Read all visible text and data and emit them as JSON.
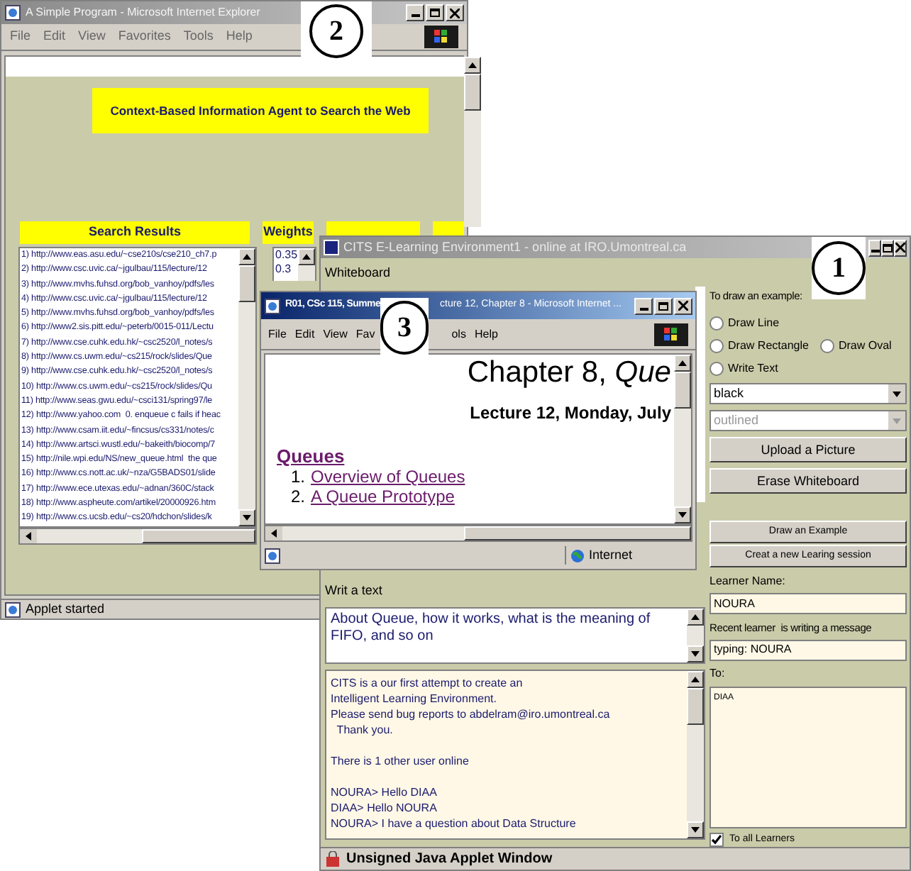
{
  "search_window": {
    "title": "A Simple Program - Microsoft Internet Explorer",
    "callout": "2",
    "menu": [
      "File",
      "Edit",
      "View",
      "Favorites",
      "Tools",
      "Help"
    ],
    "banner": "Context-Based Information Agent to Search the Web",
    "results_header": "Search Results",
    "weights_header": "Weights",
    "results": [
      "1) http://www.eas.asu.edu/~cse210s/cse210_ch7.p",
      "2) http://www.csc.uvic.ca/~jgulbau/115/lecture/12",
      "3) http://www.mvhs.fuhsd.org/bob_vanhoy/pdfs/les",
      "4) http://www.csc.uvic.ca/~jgulbau/115/lecture/12",
      "5) http://www.mvhs.fuhsd.org/bob_vanhoy/pdfs/les",
      "6) http://www2.sis.pitt.edu/~peterb/0015-011/Lectu",
      "7) http://www.cse.cuhk.edu.hk/~csc2520/l_notes/s",
      "8) http://www.cs.uwm.edu/~cs215/rock/slides/Que",
      "9) http://www.cse.cuhk.edu.hk/~csc2520/l_notes/s",
      "10) http://www.cs.uwm.edu/~cs215/rock/slides/Qu",
      "11) http://www.seas.gwu.edu/~csci131/spring97/le",
      "12) http://www.yahoo.com  0. enqueue c fails if heac",
      "13) http://www.csam.iit.edu/~fincsus/cs331/notes/c",
      "14) http://www.artsci.wustl.edu/~bakeith/biocomp/7",
      "15) http://nile.wpi.edu/NS/new_queue.html  the que",
      "16) http://www.cs.nott.ac.uk/~nza/G5BADS01/slide",
      "17) http://www.ece.utexas.edu/~adnan/360C/stack",
      "18) http://www.aspheute.com/artikel/20000926.htm",
      "19) http://www.cs.ucsb.edu/~cs20/hdchon/slides/k"
    ],
    "weights": [
      "0.35",
      "0.3"
    ],
    "status": "Applet started"
  },
  "elearning_window": {
    "title": "CITS E-Learning Environment1 - online at IRO.Umontreal.ca",
    "callout": "1",
    "whiteboard_label": "Whiteboard",
    "draw_label": "To draw an example:",
    "tools": [
      {
        "label": "Draw Line",
        "selected": false
      },
      {
        "label": "Draw Rectangle",
        "selected": false
      },
      {
        "label": "Draw Oval",
        "selected": false
      },
      {
        "label": "Write Text",
        "selected": false
      }
    ],
    "color_select": {
      "value": "black",
      "disabled": false
    },
    "fill_select": {
      "value": "outlined",
      "disabled": true
    },
    "buttons": [
      "Upload a Picture",
      "Erase Whiteboard"
    ],
    "session_buttons": [
      "Draw an Example",
      "Creat a new Learing session"
    ],
    "learner_label": "Learner Name:",
    "learner_name": "NOURA",
    "recent_label": "Recent learner  is writing a message",
    "typing": "typing: NOURA",
    "to_label": "To:",
    "to_list": [
      "DIAA"
    ],
    "to_all": {
      "label": "To all Learners",
      "checked": true
    },
    "write_label": "Writ a text",
    "message": "About Queue, how it works, what is the meaning of FIFO, and so on",
    "chat": [
      [
        "CITS is a our first attempt to create an",
        "Intelligent Learning Environment.",
        "Please send bug reports to abdelram@iro.umontreal.ca",
        "  Thank you."
      ],
      [
        "There is 1 other user online"
      ],
      [
        "NOURA> Hello DIAA",
        "DIAA> Hello NOURA",
        "NOURA> I have a question about Data Structure"
      ]
    ],
    "status": "Unsigned Java Applet Window"
  },
  "lecture_window": {
    "title_start": "R01, CSc 115, Summe",
    "title_end": "cture 12, Chapter 8 - Microsoft Internet ...",
    "callout": "3",
    "menu_start": [
      "File",
      "Edit",
      "View",
      "Fav"
    ],
    "menu_end": [
      "ols",
      "Help"
    ],
    "heading": "Chapter 8, *Que*",
    "subheading": "Lecture 12, Monday, July",
    "section": "Queues",
    "items": [
      {
        "number": "1.",
        "label": "Overview of Queues"
      },
      {
        "number": "2.",
        "label": "A Queue Prototype"
      }
    ],
    "status_zone": "Internet"
  }
}
